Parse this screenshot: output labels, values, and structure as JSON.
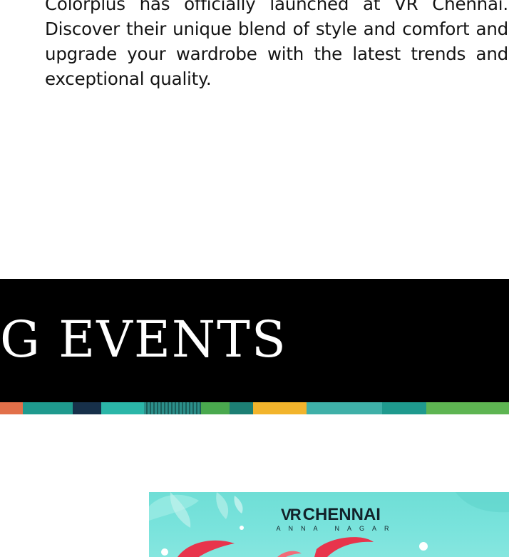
{
  "intro": {
    "text": "Colorplus has officially launched at VR Chennai. Discover their unique blend of style and comfort and upgrade your wardrobe with the latest trends and exceptional quality."
  },
  "events_banner": {
    "title": "G EVENTS"
  },
  "stripe": {
    "colors": [
      "#e2704a",
      "#1f9a8e",
      "#17304a",
      "#2bb6a8",
      "#1f9a8e",
      "#4aa94e",
      "#1d7f74",
      "#f2b42c",
      "#3fb0a8",
      "#1f9a8e",
      "#5eb552"
    ]
  },
  "poster": {
    "logo_mark": "VR",
    "logo_name": "CHENNAI",
    "logo_sub": "ANNA NAGAR",
    "background_color": "#74e0d8",
    "accent_color": "#e8344c"
  }
}
